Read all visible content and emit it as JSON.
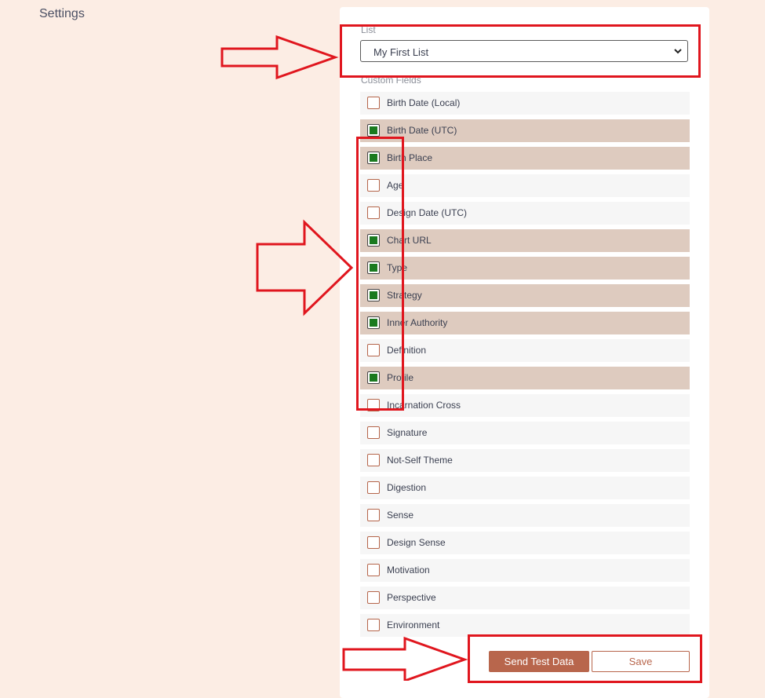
{
  "page": {
    "title": "Settings"
  },
  "list_section": {
    "label": "List",
    "selected": "My First List"
  },
  "custom_fields": {
    "label": "Custom Fields",
    "items": [
      {
        "label": "Birth Date (Local)",
        "checked": false
      },
      {
        "label": "Birth Date (UTC)",
        "checked": true
      },
      {
        "label": "Birth Place",
        "checked": true
      },
      {
        "label": "Age",
        "checked": false
      },
      {
        "label": "Design Date (UTC)",
        "checked": false
      },
      {
        "label": "Chart URL",
        "checked": true
      },
      {
        "label": "Type",
        "checked": true
      },
      {
        "label": "Strategy",
        "checked": true
      },
      {
        "label": "Inner Authority",
        "checked": true
      },
      {
        "label": "Definition",
        "checked": false
      },
      {
        "label": "Profile",
        "checked": true
      },
      {
        "label": "Incarnation Cross",
        "checked": false
      },
      {
        "label": "Signature",
        "checked": false
      },
      {
        "label": "Not-Self Theme",
        "checked": false
      },
      {
        "label": "Digestion",
        "checked": false
      },
      {
        "label": "Sense",
        "checked": false
      },
      {
        "label": "Design Sense",
        "checked": false
      },
      {
        "label": "Motivation",
        "checked": false
      },
      {
        "label": "Perspective",
        "checked": false
      },
      {
        "label": "Environment",
        "checked": false
      }
    ]
  },
  "actions": {
    "send_test_label": "Send Test Data",
    "save_label": "Save"
  },
  "colors": {
    "background": "#fcede4",
    "accent": "#b8664c",
    "checked_row": "#decbbf",
    "checkbox_fill": "#1a7a1f",
    "annotation": "#e0161e"
  }
}
